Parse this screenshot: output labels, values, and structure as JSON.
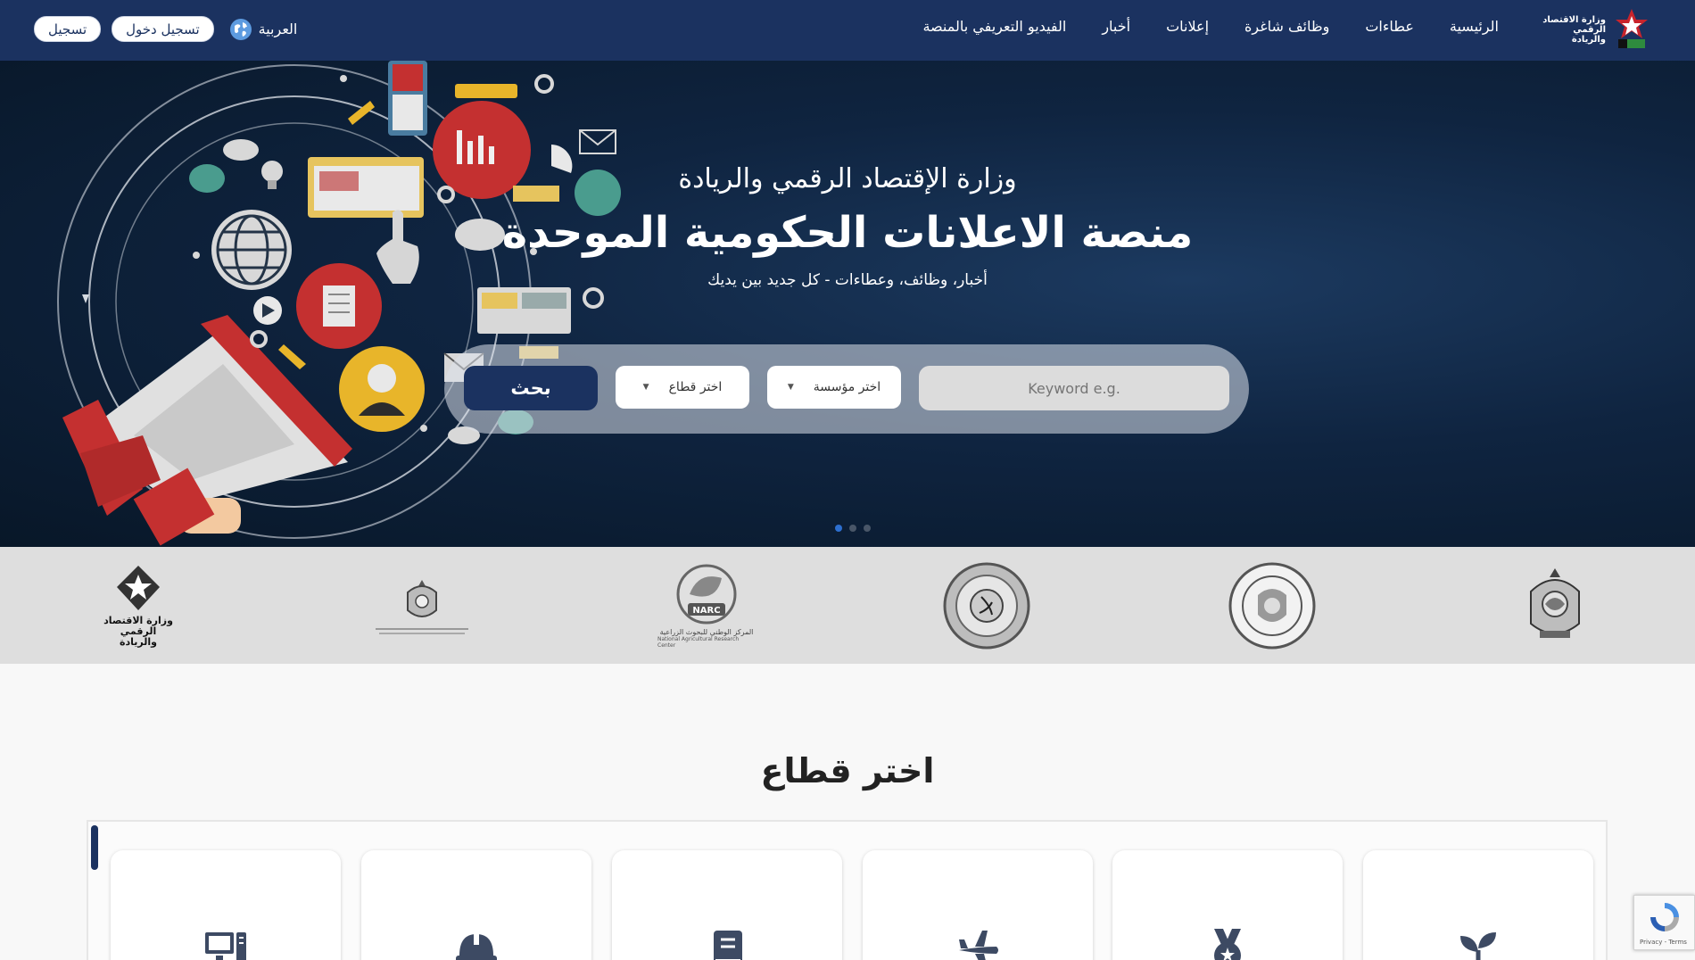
{
  "header": {
    "register_label": "تسجيل",
    "login_label": "تسجيل دخول",
    "language_label": "العربية",
    "nav_items": [
      "الرئيسية",
      "عطاءات",
      "وظائف شاغرة",
      "إعلانات",
      "أخبار",
      "الفيديو التعريفي بالمنصة"
    ],
    "logo_text": "وزارة الاقتصاد الرقمي والريادة"
  },
  "hero": {
    "ministry": "وزارة الإقتصاد الرقمي والريادة",
    "title": "منصة الاعلانات الحكومية الموحدة",
    "tagline": "أخبار، وظائف، وعطاءات - كل جديد بين يديك",
    "search": {
      "keyword_placeholder": "Keyword e.g.",
      "institution_select": "اختر مؤسسة",
      "sector_select": "اختر قطاع",
      "button_label": "بحث"
    },
    "slides": {
      "count": 3,
      "active": 1
    }
  },
  "partners": {
    "items": [
      {
        "name": "emblem-logo",
        "caption": ""
      },
      {
        "name": "social-security-logo",
        "caption": ""
      },
      {
        "name": "energy-regulatory-logo",
        "caption": ""
      },
      {
        "name": "narc-logo",
        "caption": "NARC",
        "subcaption": "المركز الوطني للبحوث الزراعية",
        "subcaption_en": "National Agricultural Research Center"
      },
      {
        "name": "higher-education-logo",
        "caption": ""
      },
      {
        "name": "modee-logo",
        "caption": "وزارة الاقتصاد الرقمي والريادة"
      }
    ]
  },
  "sectors": {
    "title": "اختر قطاع",
    "cards": [
      {
        "icon": "sprout-icon"
      },
      {
        "icon": "medal-icon"
      },
      {
        "icon": "airplane-icon"
      },
      {
        "icon": "book-icon"
      },
      {
        "icon": "hardhat-icon"
      },
      {
        "icon": "computer-icon"
      }
    ]
  },
  "recaptcha": {
    "label": "Privacy - Terms"
  },
  "colors": {
    "navy": "#1b3260",
    "accent": "#2d6fcf"
  }
}
